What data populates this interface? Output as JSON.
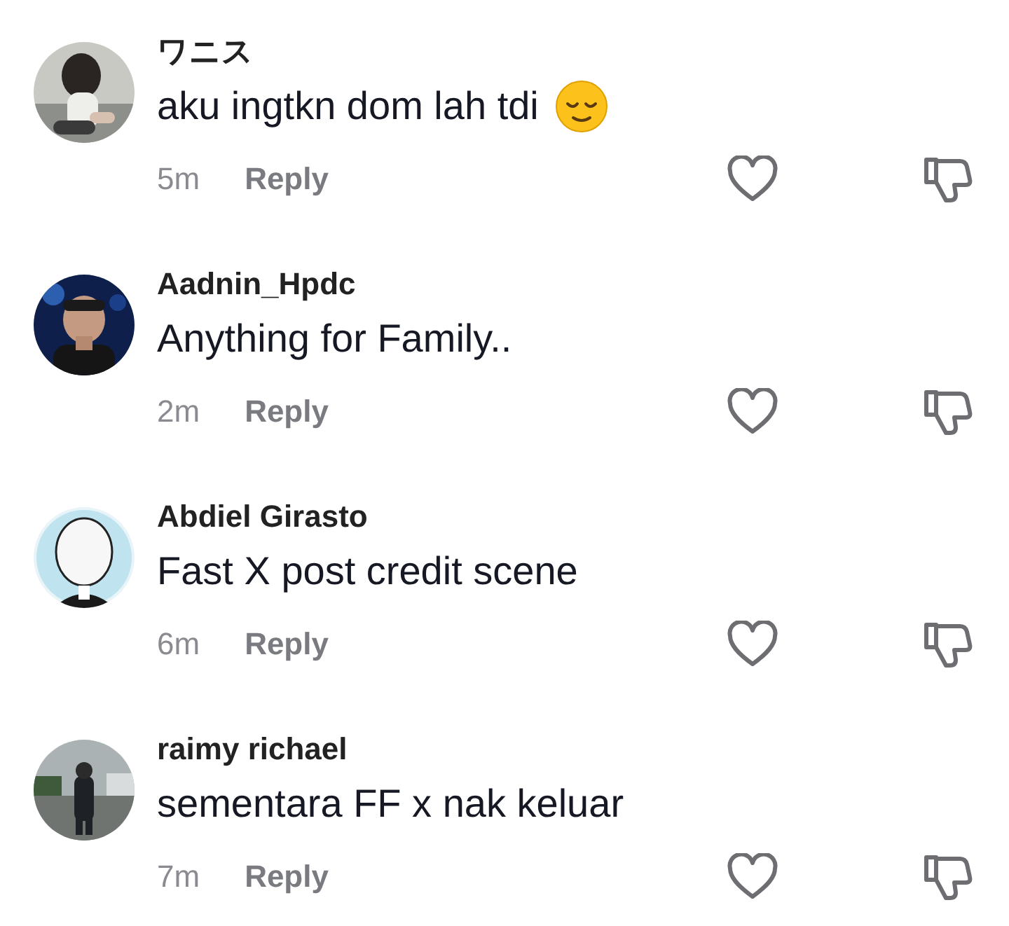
{
  "comments": [
    {
      "username": "ワニス",
      "text": "aku ingtkn dom lah tdi",
      "has_emoji": true,
      "time": "5m",
      "reply": "Reply"
    },
    {
      "username": "Aadnin_Hpdc",
      "text": "Anything for Family..",
      "has_emoji": false,
      "time": "2m",
      "reply": "Reply"
    },
    {
      "username": "Abdiel Girasto",
      "text": "Fast X post credit scene",
      "has_emoji": false,
      "time": "6m",
      "reply": "Reply"
    },
    {
      "username": "raimy richael",
      "text": "sementara FF x nak keluar",
      "has_emoji": false,
      "time": "7m",
      "reply": "Reply"
    }
  ]
}
